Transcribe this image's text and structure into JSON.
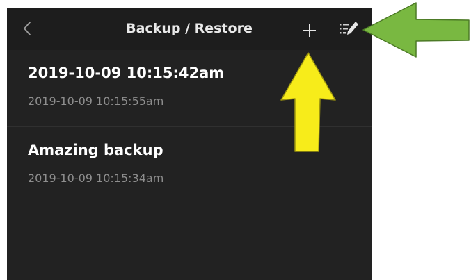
{
  "header": {
    "title": "Backup / Restore",
    "back_icon": "chevron-left-icon",
    "add_icon": "plus-icon",
    "edit_icon": "edit-list-icon"
  },
  "backups": [
    {
      "name": "2019-10-09 10:15:42am",
      "timestamp": "2019-10-09 10:15:55am"
    },
    {
      "name": "Amazing backup",
      "timestamp": "2019-10-09 10:15:34am"
    }
  ],
  "annotations": {
    "green_arrow_target": "edit-list-icon",
    "yellow_arrow_target": "plus-icon",
    "green_color": "#79b841",
    "yellow_color": "#f7ec1a"
  },
  "colors": {
    "background": "#222222",
    "navbar": "#1d1d1d",
    "title_text": "#ffffff",
    "subtitle_text": "#8e8e8e"
  }
}
